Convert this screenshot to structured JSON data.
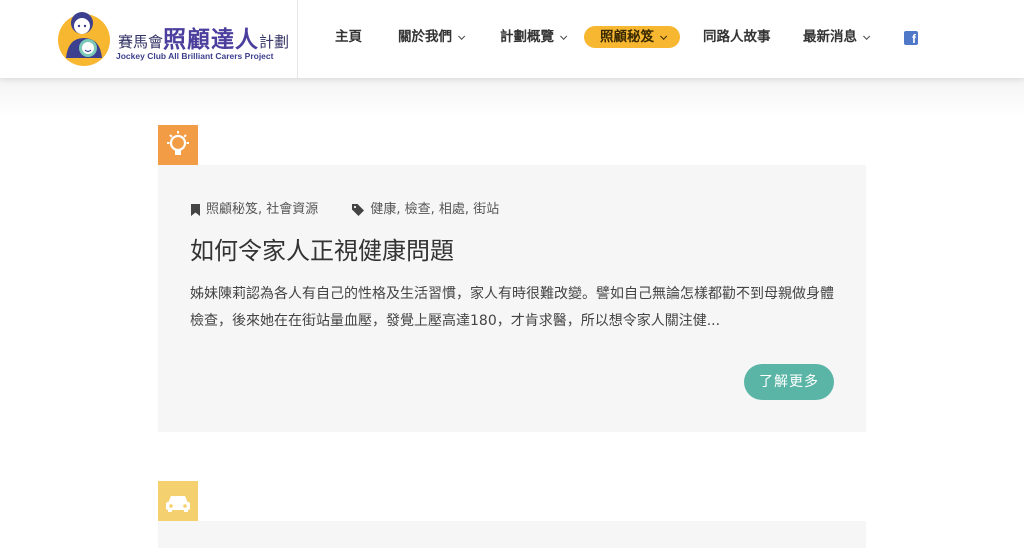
{
  "header": {
    "logo": {
      "prefix": "賽馬會",
      "main": "照顧達人",
      "suffix": "計劃",
      "english": "Jockey Club All Brilliant Carers Project"
    },
    "nav": [
      {
        "label": "主頁",
        "has_dropdown": false
      },
      {
        "label": "關於我們",
        "has_dropdown": true
      },
      {
        "label": "計劃概覽",
        "has_dropdown": true
      },
      {
        "label": "照顧秘笈",
        "has_dropdown": true,
        "active": true
      },
      {
        "label": "同路人故事",
        "has_dropdown": false
      },
      {
        "label": "最新消息",
        "has_dropdown": true
      }
    ],
    "social_icon": "facebook-icon"
  },
  "posts": [
    {
      "category_icon": "lightbulb-icon",
      "categories": "照顧秘笈, 社會資源",
      "tags": "健康, 檢查, 相處, 街站",
      "title": "如何令家人正視健康問題",
      "excerpt": "姊妹陳莉認為各人有自己的性格及生活習慣，家人有時很難改變。譬如自己無論怎樣都勸不到母親做身體檢查，後來她在在街站量血壓，發覺上壓高達180，才肯求醫，所以想令家人關注健...",
      "more_label": "了解更多"
    },
    {
      "category_icon": "car-icon"
    }
  ],
  "colors": {
    "nav_active": "#f7b731",
    "button": "#5ab5a6",
    "bulb_bg": "#f29d46",
    "car_bg": "#f5d06e",
    "card_bg": "#f6f6f6"
  }
}
